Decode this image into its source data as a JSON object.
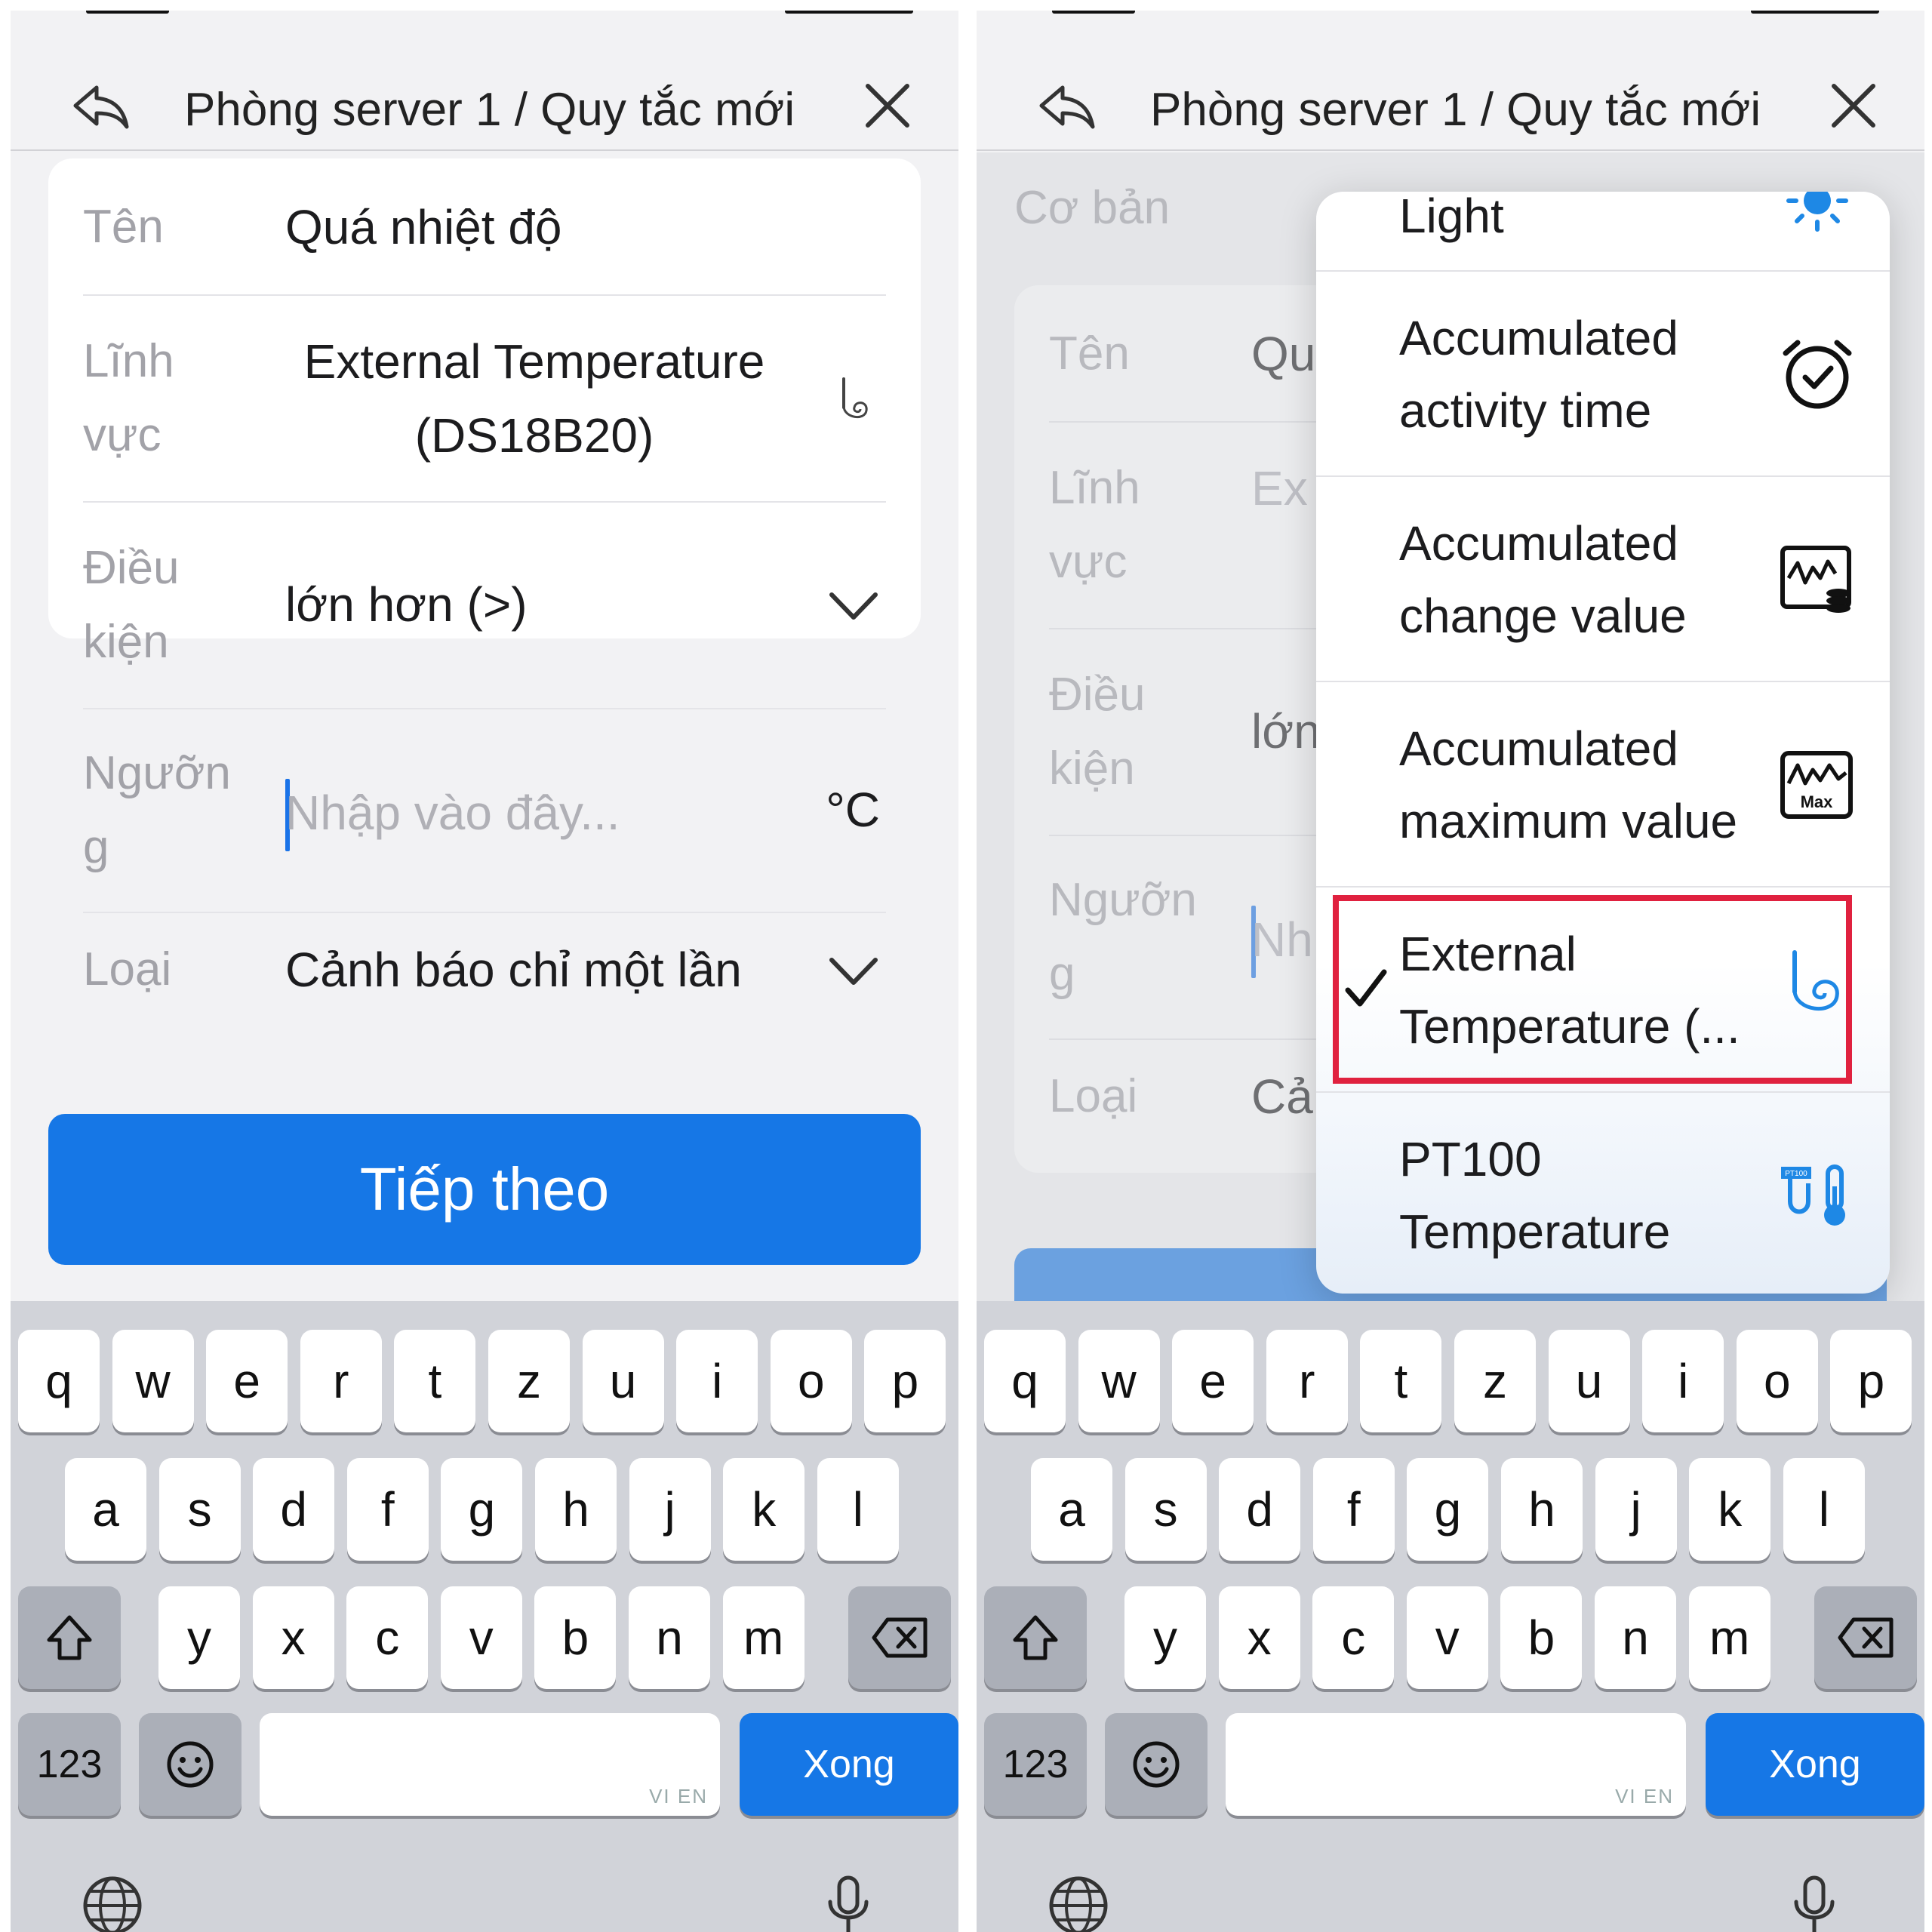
{
  "left": {
    "title": "Phòng server 1 / Quy tắc mới",
    "fields": {
      "name_label": "Tên",
      "name_value": "Quá nhiệt độ",
      "domain_label_1": "Lĩnh",
      "domain_label_2": "vực",
      "domain_value_1": "External Temperature",
      "domain_value_2": "(DS18B20)",
      "condition_label_1": "Điều",
      "condition_label_2": "kiện",
      "condition_value": "lớn hơn (>)",
      "threshold_label_1": "Ngưỡn",
      "threshold_label_2": "g",
      "threshold_placeholder": "Nhập vào đây...",
      "threshold_unit": "°C",
      "type_label": "Loại",
      "type_value": "Cảnh báo chỉ một lần"
    },
    "next_button": "Tiếp theo"
  },
  "right": {
    "title": "Phòng server 1 / Quy tắc mới",
    "section_label": "Cơ bản",
    "fields": {
      "name_label": "Tên",
      "name_value": "Qu",
      "domain_label_1": "Lĩnh",
      "domain_label_2": "vực",
      "domain_value": "Ex",
      "condition_label_1": "Điều",
      "condition_label_2": "kiện",
      "condition_value": "lớn",
      "threshold_label_1": "Ngưỡn",
      "threshold_label_2": "g",
      "threshold_placeholder": "Nh",
      "type_label": "Loại",
      "type_value": "Cả"
    },
    "dropdown": {
      "items": [
        {
          "line1": "Light",
          "line2": "",
          "icon": "sun-icon",
          "selected": false
        },
        {
          "line1": "Accumulated",
          "line2": "activity time",
          "icon": "alarm-clock-check-icon",
          "selected": false
        },
        {
          "line1": "Accumulated",
          "line2": "change value",
          "icon": "waveform-stack-icon",
          "selected": false
        },
        {
          "line1": "Accumulated",
          "line2": "maximum value",
          "icon": "waveform-max-icon",
          "selected": false
        },
        {
          "line1": "External",
          "line2": "Temperature (...",
          "icon": "temperature-probe-icon",
          "selected": true
        },
        {
          "line1": "PT100",
          "line2": "Temperature",
          "icon": "pt100-thermometer-icon",
          "selected": false
        }
      ],
      "max_badge": "Max",
      "pt100_badge": "PT100"
    }
  },
  "keyboard": {
    "row1": [
      "q",
      "w",
      "e",
      "r",
      "t",
      "z",
      "u",
      "i",
      "o",
      "p"
    ],
    "row2": [
      "a",
      "s",
      "d",
      "f",
      "g",
      "h",
      "j",
      "k",
      "l"
    ],
    "row3": [
      "y",
      "x",
      "c",
      "v",
      "b",
      "n",
      "m"
    ],
    "num_key": "123",
    "done_key": "Xong",
    "space_hint": "VI EN"
  },
  "colors": {
    "accent": "#1677e6",
    "highlight_border": "#e0213f",
    "icon_blue": "#1e88e5"
  }
}
